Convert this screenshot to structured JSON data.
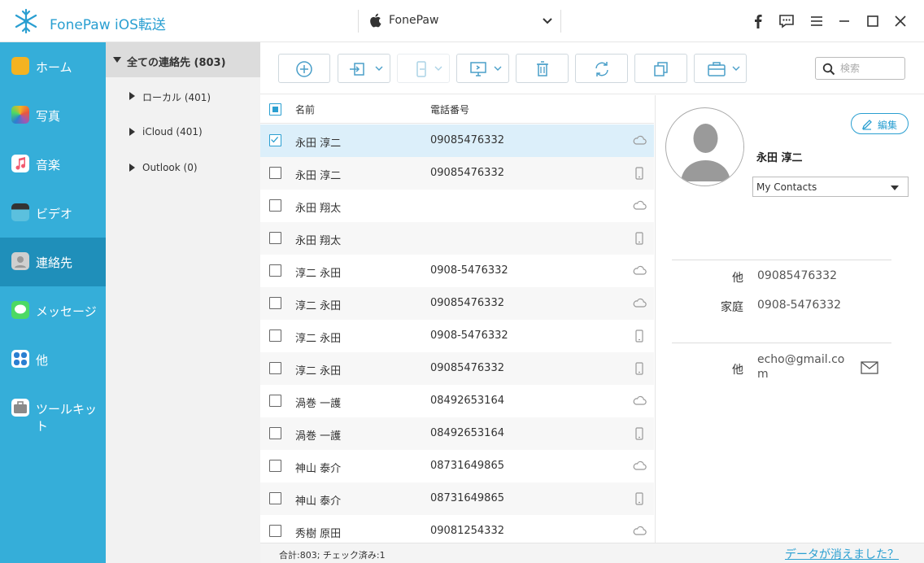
{
  "app": {
    "title": "FonePaw iOS転送",
    "device": "FonePaw"
  },
  "colors": {
    "accent": "#35aed9",
    "active": "#1f8fba",
    "link": "#2a9fd1",
    "selected_row": "#dceffa"
  },
  "sidebar": {
    "items": [
      {
        "label": "ホーム",
        "icon": "home-icon",
        "color": "#f4b321"
      },
      {
        "label": "写真",
        "icon": "photos-icon",
        "color": "#e9573f"
      },
      {
        "label": "音楽",
        "icon": "music-icon",
        "color": "#f25a6f"
      },
      {
        "label": "ビデオ",
        "icon": "video-icon",
        "color": "#5bc0de"
      },
      {
        "label": "連絡先",
        "icon": "contacts-icon",
        "color": "#bbbbbb",
        "active": true
      },
      {
        "label": "メッセージ",
        "icon": "messages-icon",
        "color": "#4cd964"
      },
      {
        "label": "他",
        "icon": "other-icon",
        "color": "#2a7fd1"
      },
      {
        "label": "ツールキット",
        "icon": "toolkit-icon",
        "color": "#8a8a8a"
      }
    ]
  },
  "tree": {
    "root": "全ての連絡先 (803)",
    "children": [
      "ローカル (401)",
      "iCloud (401)",
      "Outlook (0)"
    ]
  },
  "toolbar": {
    "buttons": [
      "add-icon",
      "import-icon",
      "export-to-device-icon",
      "export-to-pc-icon",
      "delete-icon",
      "refresh-icon",
      "duplicate-icon",
      "toolbox-icon"
    ],
    "search_placeholder": "検索"
  },
  "table": {
    "headers": {
      "name": "名前",
      "phone": "電話番号"
    },
    "rows": [
      {
        "name": "永田 淳二",
        "phone": "09085476332",
        "source": "cloud-icon",
        "checked": true
      },
      {
        "name": "永田 淳二",
        "phone": "09085476332",
        "source": "phone-icon",
        "checked": false
      },
      {
        "name": "永田 翔太",
        "phone": "",
        "source": "cloud-icon",
        "checked": false
      },
      {
        "name": "永田 翔太",
        "phone": "",
        "source": "phone-icon",
        "checked": false
      },
      {
        "name": "淳二 永田",
        "phone": "0908-5476332",
        "source": "cloud-icon",
        "checked": false
      },
      {
        "name": "淳二 永田",
        "phone": "09085476332",
        "source": "cloud-icon",
        "checked": false
      },
      {
        "name": "淳二 永田",
        "phone": "0908-5476332",
        "source": "phone-icon",
        "checked": false
      },
      {
        "name": "淳二 永田",
        "phone": "09085476332",
        "source": "phone-icon",
        "checked": false
      },
      {
        "name": "渦巻 一護",
        "phone": "08492653164",
        "source": "cloud-icon",
        "checked": false
      },
      {
        "name": "渦巻 一護",
        "phone": "08492653164",
        "source": "phone-icon",
        "checked": false
      },
      {
        "name": "神山 泰介",
        "phone": "08731649865",
        "source": "cloud-icon",
        "checked": false
      },
      {
        "name": "神山 泰介",
        "phone": "08731649865",
        "source": "phone-icon",
        "checked": false
      },
      {
        "name": "秀樹 原田",
        "phone": "09081254332",
        "source": "cloud-icon",
        "checked": false
      }
    ]
  },
  "detail": {
    "edit_label": "編集",
    "name": "永田 淳二",
    "group": "My Contacts",
    "phones": [
      {
        "label": "他",
        "value": "09085476332"
      },
      {
        "label": "家庭",
        "value": "0908-5476332"
      }
    ],
    "email": {
      "label": "他",
      "line1": "echo@gmail.co",
      "line2": "m"
    }
  },
  "status": {
    "summary": "合計:803; チェック済み:1",
    "lost_link": "データが消えました？"
  }
}
